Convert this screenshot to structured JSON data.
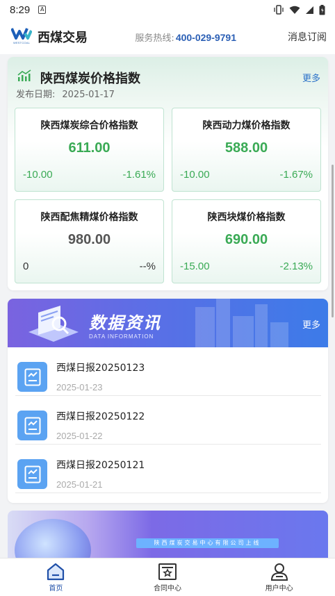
{
  "status_bar": {
    "time": "8:29"
  },
  "header": {
    "app_name": "西煤交易",
    "logo_sub": "WESTCOAL",
    "hotline_label": "服务热线:",
    "hotline_number": "400-029-9791",
    "subscribe_label": "消息订阅"
  },
  "price_index": {
    "title": "陕西煤炭价格指数",
    "more": "更多",
    "date_label": "发布日期:",
    "date": "2025-01-17",
    "tiles": [
      {
        "name": "陕西煤炭综合价格指数",
        "value": "611.00",
        "change": "-10.00",
        "percent": "-1.61%"
      },
      {
        "name": "陕西动力煤价格指数",
        "value": "588.00",
        "change": "-10.00",
        "percent": "-1.67%"
      },
      {
        "name": "陕西配焦精煤价格指数",
        "value": "980.00",
        "change": "0",
        "percent": "--%"
      },
      {
        "name": "陕西块煤价格指数",
        "value": "690.00",
        "change": "-15.00",
        "percent": "-2.13%"
      }
    ],
    "colors": {
      "down": "#3aaa55",
      "flat": "#555555"
    }
  },
  "news": {
    "banner_title": "数据资讯",
    "banner_sub": "DATA INFORMATION",
    "more": "更多",
    "items": [
      {
        "title": "西煤日报20250123",
        "date": "2025-01-23"
      },
      {
        "title": "西煤日报20250122",
        "date": "2025-01-22"
      },
      {
        "title": "西煤日报20250121",
        "date": "2025-01-21"
      }
    ]
  },
  "promo": {
    "tag": "陕西煤炭交易中心有限公司上线"
  },
  "tabbar": {
    "items": [
      {
        "label": "首页",
        "icon": "home-icon",
        "active": true
      },
      {
        "label": "合同中心",
        "icon": "contract-icon",
        "active": false
      },
      {
        "label": "用户中心",
        "icon": "user-icon",
        "active": false
      }
    ]
  }
}
